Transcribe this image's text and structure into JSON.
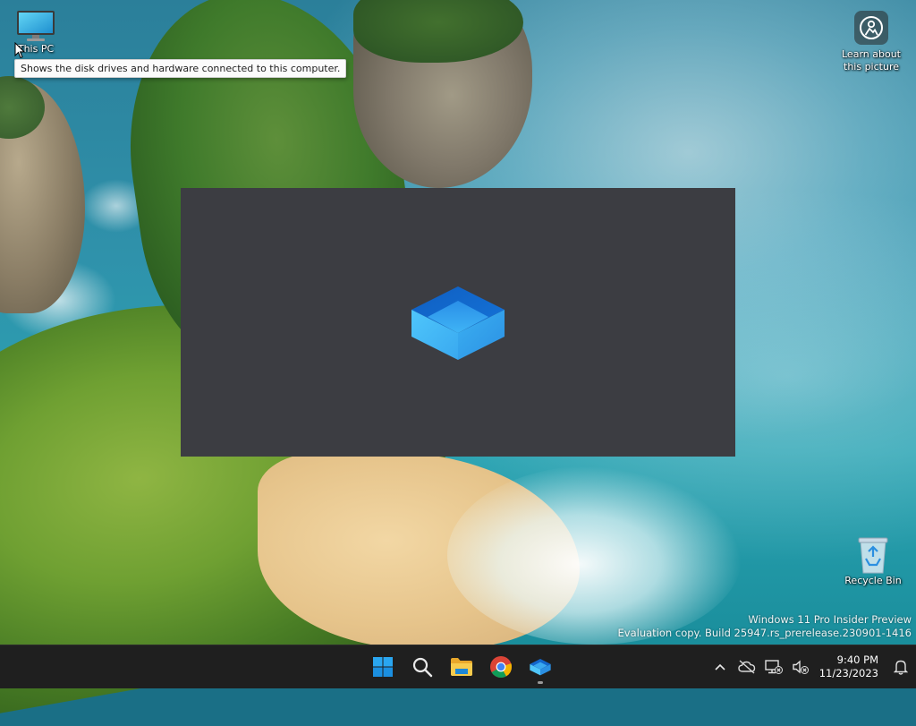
{
  "desktop": {
    "icons": {
      "this_pc": {
        "label": "This PC",
        "icon": "monitor-icon"
      },
      "learn": {
        "label": "Learn about this picture",
        "icon": "learn-about-picture-icon"
      },
      "recycle": {
        "label": "Recycle Bin",
        "icon": "recycle-bin-icon"
      }
    },
    "tooltip": "Shows the disk drives and hardware connected to this computer."
  },
  "splash": {
    "icon": "windows-sandbox-icon",
    "background": "#3c3d42"
  },
  "watermark": {
    "line1": "Windows 11 Pro Insider Preview",
    "line2": "Evaluation copy. Build 25947.rs_prerelease.230901-1416"
  },
  "taskbar": {
    "apps": [
      {
        "name": "Start",
        "icon": "windows-start-icon"
      },
      {
        "name": "Search",
        "icon": "search-icon"
      },
      {
        "name": "File Explorer",
        "icon": "folder-icon"
      },
      {
        "name": "Google Chrome",
        "icon": "chrome-icon"
      },
      {
        "name": "Windows Sandbox",
        "icon": "windows-sandbox-icon",
        "running": true
      }
    ],
    "tray": {
      "time": "9:40 PM",
      "date": "11/23/2023"
    }
  },
  "colors": {
    "taskbar": "#1f1f1f",
    "tooltip_bg": "#fbfbfb",
    "accent_blue": "#2b8fe0"
  }
}
